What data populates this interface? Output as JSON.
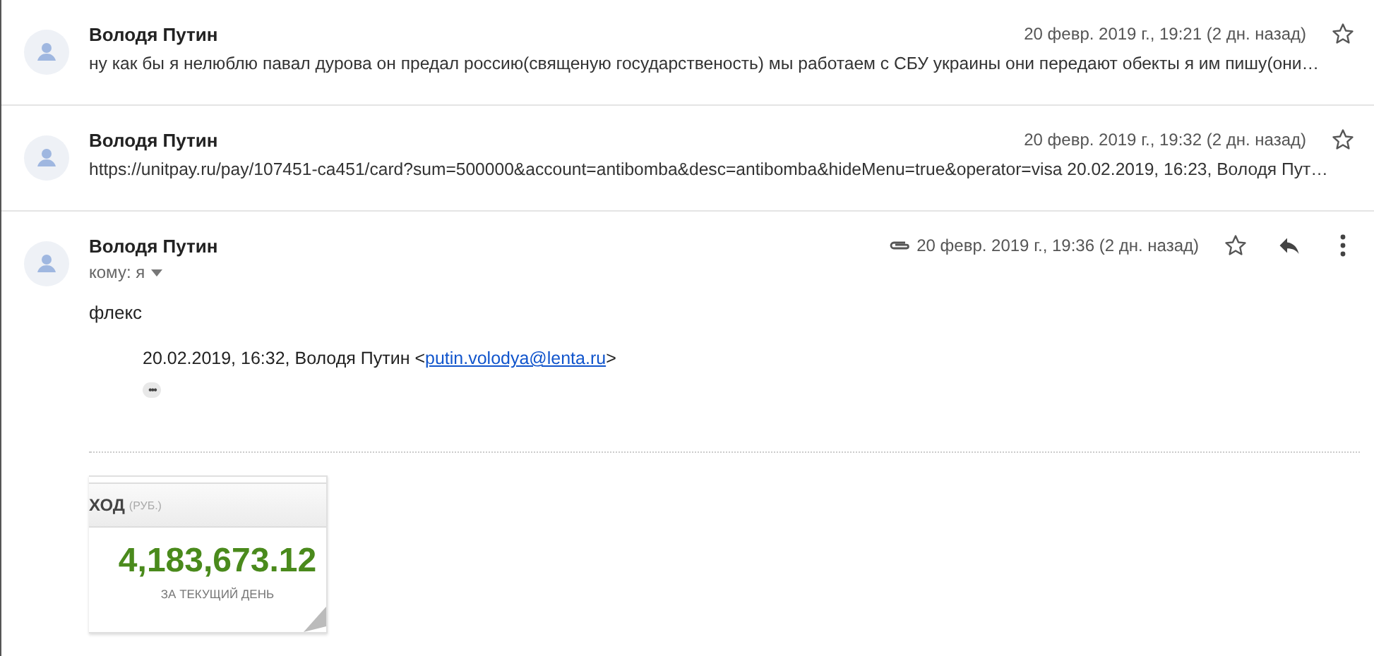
{
  "messages": [
    {
      "kind": "collapsed",
      "sender": "Володя Путин",
      "date": "20 февр. 2019 г., 19:21 (2 дн. назад)",
      "starred": false,
      "snippet": "ну как бы я нелюблю павал дурова он предал россию(священую государственость) мы работаем с СБУ украины они передают обекты я им пишу(они…"
    },
    {
      "kind": "collapsed",
      "sender": "Володя Путин",
      "date": "20 февр. 2019 г., 19:32 (2 дн. назад)",
      "starred": false,
      "snippet": "https://unitpay.ru/pay/107451-ca451/card?sum=500000&account=antibomba&desc=antibomba&hideMenu=true&operator=visa 20.02.2019, 16:23, Володя Пут…"
    },
    {
      "kind": "expanded",
      "sender": "Володя Путин",
      "recipient": "кому: я",
      "date": "20 февр. 2019 г., 19:36 (2 дн. назад)",
      "starred": false,
      "has_attachment": true,
      "body": "флекс",
      "quote": {
        "prefix": "20.02.2019, 16:32, Володя Путин <",
        "email": "putin.volodya@lenta.ru",
        "suffix": ">"
      },
      "more": "•••",
      "image": {
        "header": "ХОД",
        "unit": "(РУБ.)",
        "amount": "4,183,673.12",
        "caption": "ЗА ТЕКУЩИЙ ДЕНЬ"
      }
    }
  ]
}
